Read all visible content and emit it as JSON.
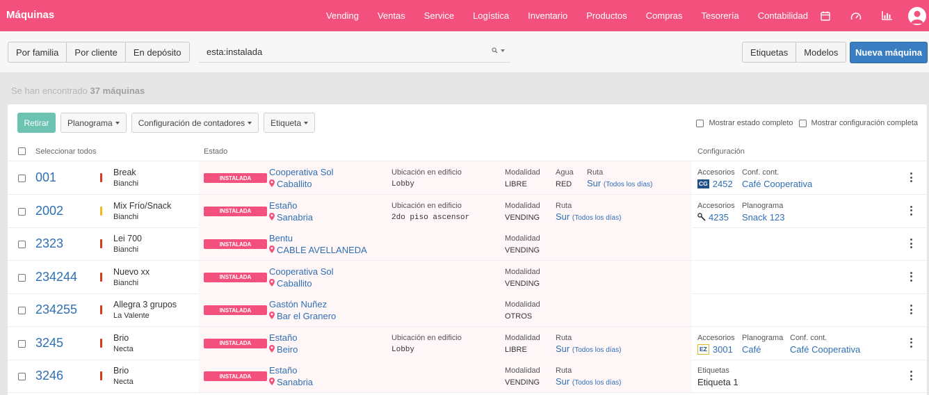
{
  "app": {
    "title": "Máquinas",
    "nav": [
      "Vending",
      "Ventas",
      "Service",
      "Logística",
      "Inventario",
      "Productos",
      "Compras",
      "Tesorería",
      "Contabilidad"
    ],
    "nav_icons": [
      "calendar-icon",
      "speedometer-icon",
      "bar-chart-icon",
      "user-avatar-icon"
    ]
  },
  "toolbar": {
    "filters": [
      "Por familia",
      "Por cliente",
      "En depósito"
    ],
    "search_value": "esta:instalada",
    "right_buttons": [
      "Etiquetas",
      "Modelos"
    ],
    "primary": "Nueva máquina"
  },
  "summary": {
    "prefix": "Se han encontrado",
    "count": "37 máquinas"
  },
  "actions": {
    "retirar": "Retirar",
    "dropdowns": [
      "Planograma",
      "Configuración de contadores",
      "Etiqueta"
    ],
    "show_state": "Mostrar estado completo",
    "show_config": "Mostrar configuración completa"
  },
  "table": {
    "select_all": "Seleccionar todos",
    "estado": "Estado",
    "configuracion": "Configuración"
  },
  "colors": {
    "primary_pink": "#f4507e",
    "link_blue": "#2f6fb3",
    "primary_button": "#3a7dc1",
    "retirar_green": "#6cc3b1"
  },
  "rows": [
    {
      "num": "001",
      "model": "Break",
      "brand": "Bianchi",
      "bar": "#d73a1e",
      "status": "INSTALADA",
      "client": "Cooperativa Sol",
      "location": "Caballito",
      "ubicacion_lbl": "Ubicación en edificio",
      "ubicacion_val": "Lobby",
      "modalidad_lbl": "Modalidad",
      "modalidad_val": "LIBRE",
      "agua_lbl": "Agua",
      "agua_val": "RED",
      "ruta_lbl": "Ruta",
      "ruta_val": "Sur",
      "ruta_days": "(Todos los días)",
      "cfg": [
        {
          "lbl": "Accesorios",
          "tag": "CG",
          "val": "2452"
        },
        {
          "lbl": "Conf. cont.",
          "val": "Café Cooperativa"
        }
      ]
    },
    {
      "num": "2002",
      "model": "Mix Frío/Snack",
      "brand": "Bianchi",
      "bar": "#f2b81c",
      "status": "INSTALADA",
      "client": "Estaño",
      "location": "Sanabria",
      "ubicacion_lbl": "Ubicación en edificio",
      "ubicacion_val": "2do piso ascensor",
      "modalidad_lbl": "Modalidad",
      "modalidad_val": "VENDING",
      "ruta_lbl": "Ruta",
      "ruta_val": "Sur",
      "ruta_days": "(Todos los días)",
      "cfg": [
        {
          "lbl": "Accesorios",
          "icon": "wrench-icon",
          "val": "4235"
        },
        {
          "lbl": "Planograma",
          "val": "Snack 123"
        }
      ]
    },
    {
      "num": "2323",
      "model": "Lei 700",
      "brand": "Bianchi",
      "bar": "#d73a1e",
      "status": "INSTALADA",
      "client": "Bentu",
      "location": "CABLE AVELLANEDA",
      "modalidad_lbl": "Modalidad",
      "modalidad_val": "VENDING",
      "cfg": []
    },
    {
      "num": "234244",
      "model": "Nuevo xx",
      "brand": "Bianchi",
      "bar": "#d73a1e",
      "status": "INSTALADA",
      "client": "Cooperativa Sol",
      "location": "Caballito",
      "modalidad_lbl": "Modalidad",
      "modalidad_val": "VENDING",
      "cfg": []
    },
    {
      "num": "234255",
      "model": "Allegra 3 grupos",
      "brand": "La Valente",
      "bar": "#d73a1e",
      "status": "INSTALADA",
      "client": "Gastón Nuñez",
      "location": "Bar el Granero",
      "modalidad_lbl": "Modalidad",
      "modalidad_val": "OTROS",
      "cfg": []
    },
    {
      "num": "3245",
      "model": "Brio",
      "brand": "Necta",
      "bar": "#d73a1e",
      "status": "INSTALADA",
      "client": "Estaño",
      "location": "Beiro",
      "ubicacion_lbl": "Ubicación en edificio",
      "ubicacion_val": "Lobby",
      "modalidad_lbl": "Modalidad",
      "modalidad_val": "LIBRE",
      "ruta_lbl": "Ruta",
      "ruta_val": "Sur",
      "ruta_days": "(Todos los días)",
      "cfg": [
        {
          "lbl": "Accesorios",
          "tag": "EZ",
          "val": "3001"
        },
        {
          "lbl": "Planograma",
          "val": "Café"
        },
        {
          "lbl": "Conf. cont.",
          "val": "Café Cooperativa"
        }
      ]
    },
    {
      "num": "3246",
      "model": "Brio",
      "brand": "Necta",
      "bar": "#d73a1e",
      "status": "INSTALADA",
      "client": "Estaño",
      "location": "Sanabria",
      "modalidad_lbl": "Modalidad",
      "modalidad_val": "VENDING",
      "ruta_lbl": "Ruta",
      "ruta_val": "Sur",
      "ruta_days": "(Todos los días)",
      "cfg": [
        {
          "lbl": "Etiquetas",
          "val": "Etiqueta 1",
          "plain": true
        }
      ]
    }
  ]
}
